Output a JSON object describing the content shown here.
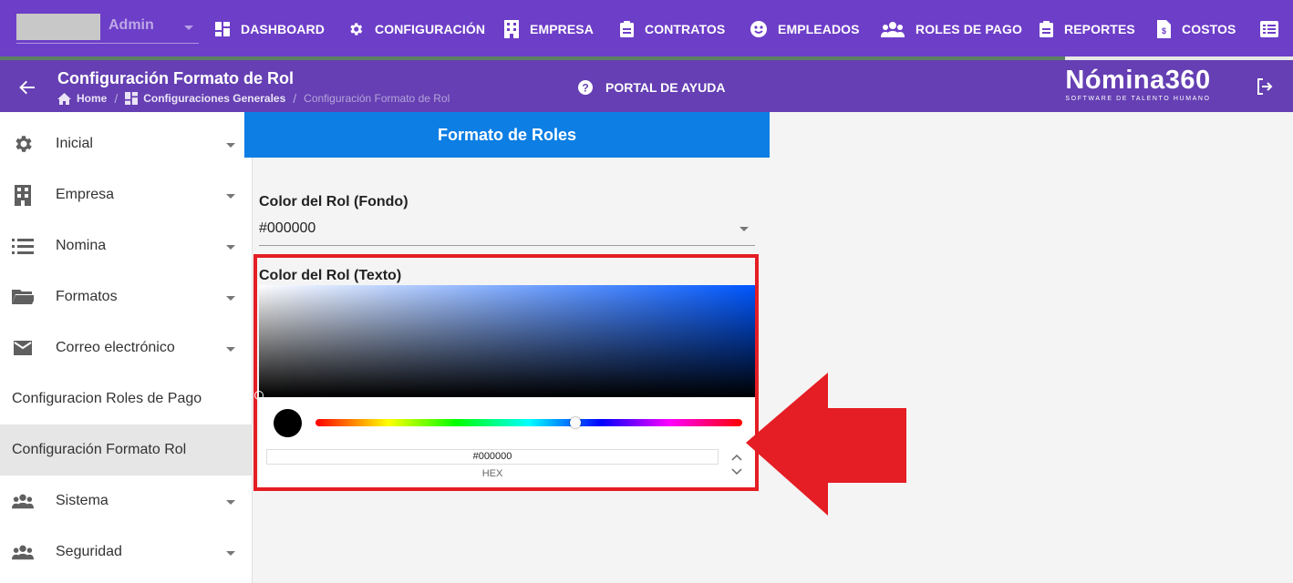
{
  "topnav": {
    "user_name": "Admin",
    "items": [
      {
        "label": "DASHBOARD",
        "icon": "dashboard-icon"
      },
      {
        "label": "CONFIGURACIÓN",
        "icon": "gear-icon"
      },
      {
        "label": "EMPRESA",
        "icon": "building-icon"
      },
      {
        "label": "CONTRATOS",
        "icon": "clipboard-icon"
      },
      {
        "label": "EMPLEADOS",
        "icon": "face-icon"
      },
      {
        "label": "ROLES DE PAGO",
        "icon": "users-icon"
      },
      {
        "label": "REPORTES",
        "icon": "clipboard-list-icon"
      },
      {
        "label": "COSTOS",
        "icon": "file-dollar-icon"
      },
      {
        "label": "",
        "icon": "list-box-icon"
      }
    ]
  },
  "header": {
    "title": "Configuración Formato de Rol",
    "breadcrumb": [
      "Home",
      "Configuraciones Generales",
      "Configuración Formato de Rol"
    ],
    "help_label": "PORTAL DE AYUDA",
    "brand_name": "Nómina360",
    "brand_tagline": "SOFTWARE DE TALENTO HUMANO"
  },
  "sidebar": {
    "items": [
      {
        "label": "Inicial",
        "icon": "gear-icon",
        "expandable": true
      },
      {
        "label": "Empresa",
        "icon": "building-icon",
        "expandable": true
      },
      {
        "label": "Nomina",
        "icon": "list-icon",
        "expandable": true
      },
      {
        "label": "Formatos",
        "icon": "folder-open-icon",
        "expandable": true
      },
      {
        "label": "Correo electrónico",
        "icon": "mail-icon",
        "expandable": true
      },
      {
        "label": "Configuracion Roles de Pago",
        "icon": "",
        "expandable": false
      },
      {
        "label": "Configuración Formato Rol",
        "icon": "",
        "expandable": false,
        "active": true
      },
      {
        "label": "Sistema",
        "icon": "users-icon",
        "expandable": true
      },
      {
        "label": "Seguridad",
        "icon": "users-icon",
        "expandable": true
      }
    ]
  },
  "main": {
    "card_title": "Formato de Roles",
    "background_color": {
      "label": "Color del Rol (Fondo)",
      "value": "#000000"
    },
    "text_color": {
      "label": "Color del Rol (Texto)",
      "value": "#000000",
      "mode_label": "HEX",
      "hue_color": "#0057ff"
    }
  },
  "colors": {
    "nav_bg": "#6d3ec8",
    "subheader_bg": "#653fb3",
    "card_header_bg": "#0c7ee4",
    "highlight_red": "#e51d24"
  }
}
